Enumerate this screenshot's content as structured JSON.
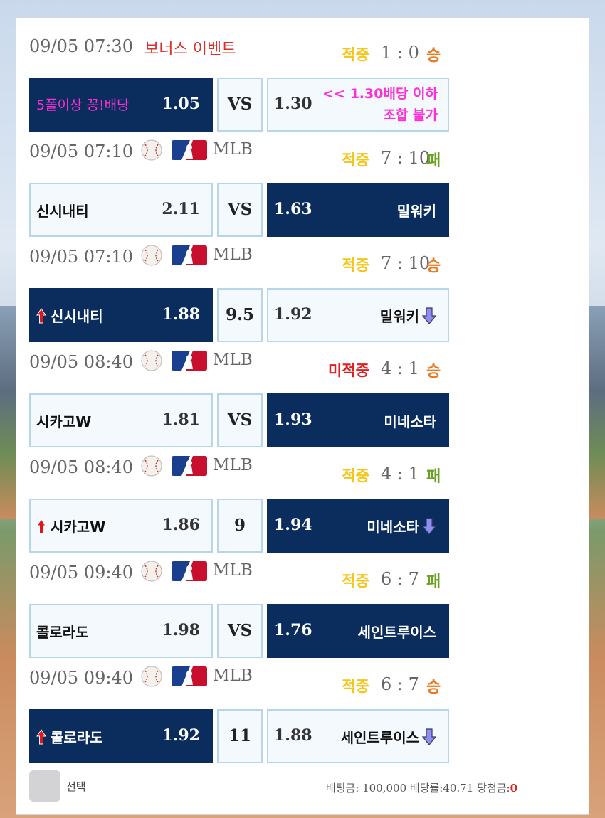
{
  "event_row": {
    "time": "09/05 07:30",
    "title": "보너스 이벤트",
    "status": "적중",
    "score": "1 : 0",
    "result": "승",
    "left_label": "5폴이상 꽁!배당",
    "left_odds": "1.05",
    "middle": "VS",
    "right_odds": "1.30",
    "right_note_line1": "<< 1.30배당 이하",
    "right_note_line2": "조합 불가"
  },
  "games": [
    {
      "time": "09/05 07:10",
      "league": "MLB",
      "status": "적중",
      "status_type": "hit",
      "score": "7 : 10",
      "result": "패",
      "result_type": "lose",
      "home": "신시내티",
      "home_odds": "2.11",
      "middle": "VS",
      "away_odds": "1.63",
      "away": "밀워키",
      "selected": "away",
      "home_arrow": false,
      "away_arrow": false
    },
    {
      "time": "09/05 07:10",
      "league": "MLB",
      "status": "적중",
      "status_type": "hit",
      "score": "7 : 10",
      "result": "승",
      "result_type": "win",
      "home": "신시내티",
      "home_odds": "1.88",
      "middle": "9.5",
      "away_odds": "1.92",
      "away": "밀워키",
      "selected": "home",
      "home_arrow": true,
      "away_arrow": true
    },
    {
      "time": "09/05 08:40",
      "league": "MLB",
      "status": "미적중",
      "status_type": "miss",
      "score": "4 : 1",
      "result": "승",
      "result_type": "win",
      "home": "시카고W",
      "home_odds": "1.81",
      "middle": "VS",
      "away_odds": "1.93",
      "away": "미네소타",
      "selected": "away",
      "home_arrow": false,
      "away_arrow": false
    },
    {
      "time": "09/05 08:40",
      "league": "MLB",
      "status": "적중",
      "status_type": "hit",
      "score": "4 : 1",
      "result": "패",
      "result_type": "lose",
      "home": "시카고W",
      "home_odds": "1.86",
      "middle": "9",
      "away_odds": "1.94",
      "away": "미네소타",
      "selected": "away",
      "home_arrow": true,
      "away_arrow": true
    },
    {
      "time": "09/05 09:40",
      "league": "MLB",
      "status": "적중",
      "status_type": "hit",
      "score": "6 : 7",
      "result": "패",
      "result_type": "lose",
      "home": "콜로라도",
      "home_odds": "1.98",
      "middle": "VS",
      "away_odds": "1.76",
      "away": "세인트루이스",
      "selected": "away",
      "home_arrow": false,
      "away_arrow": false
    },
    {
      "time": "09/05 09:40",
      "league": "MLB",
      "status": "적중",
      "status_type": "hit",
      "score": "6 : 7",
      "result": "승",
      "result_type": "win",
      "home": "콜로라도",
      "home_odds": "1.92",
      "middle": "11",
      "away_odds": "1.88",
      "away": "세인트루이스",
      "selected": "home",
      "home_arrow": true,
      "away_arrow": true
    }
  ],
  "footer": {
    "select_label": "선택",
    "bet_amount_label": "배팅금:",
    "bet_amount": "100,000",
    "odds_rate_label": "배당률:",
    "odds_rate": "40.71",
    "win_amount_label": "당첨금:",
    "win_amount": "0"
  },
  "colors": {
    "selected_box": "#0a2d5e",
    "box_border": "#b8d6ea",
    "hit": "#f5c518",
    "miss": "#e01e1e",
    "win": "#e87b20",
    "lose": "#6aa121",
    "event_title": "#d9312a",
    "note": "#ff2fd6"
  }
}
